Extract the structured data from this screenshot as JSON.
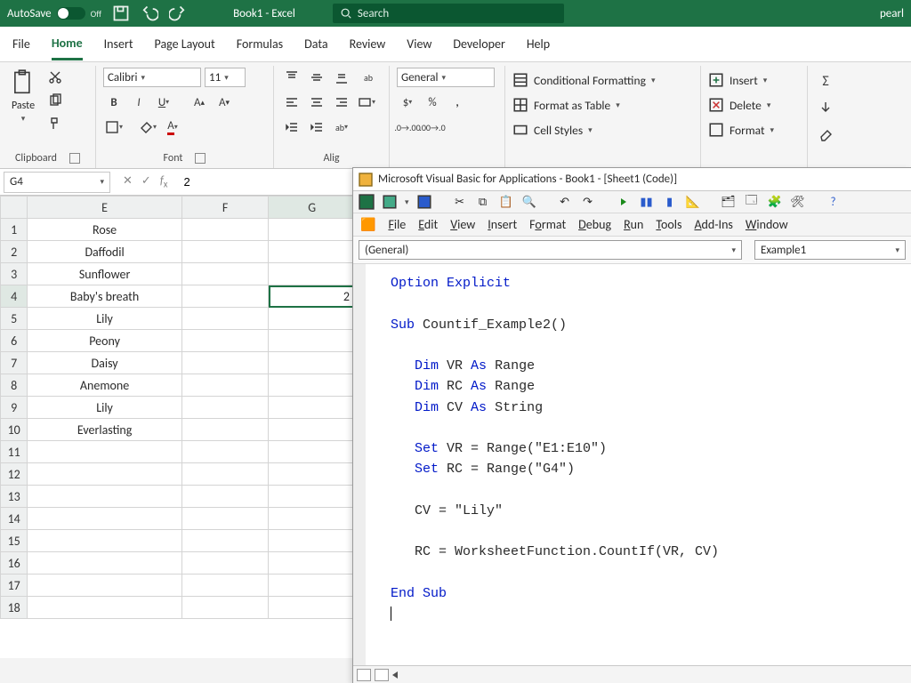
{
  "titlebar": {
    "autosave": "AutoSave",
    "autosave_state": "Off",
    "booktitle": "Book1 - Excel",
    "search_placeholder": "Search",
    "user": "pearl"
  },
  "tabs": {
    "file": "File",
    "home": "Home",
    "insert": "Insert",
    "page_layout": "Page Layout",
    "formulas": "Formulas",
    "data": "Data",
    "review": "Review",
    "view": "View",
    "developer": "Developer",
    "help": "Help"
  },
  "ribbon": {
    "clipboard": {
      "label": "Clipboard",
      "paste": "Paste"
    },
    "font": {
      "label": "Font",
      "name": "Calibri",
      "size": "11"
    },
    "alignment": {
      "label": "Alig"
    },
    "number": {
      "format": "General"
    },
    "styles": {
      "cond_fmt": "Conditional Formatting",
      "fmt_table": "Format as Table",
      "cell_styles": "Cell Styles"
    },
    "cells": {
      "insert": "Insert",
      "delete": "Delete",
      "format": "Format"
    }
  },
  "fxbar": {
    "namebox": "G4",
    "value": "2"
  },
  "grid": {
    "col_e": "E",
    "col_f": "F",
    "col_g": "G",
    "rows": [
      "Rose",
      "Daffodil",
      "Sunflower",
      "Baby's breath",
      "Lily",
      "Peony",
      "Daisy",
      "Anemone",
      "Lily",
      "Everlasting",
      "",
      "",
      "",
      "",
      "",
      "",
      "",
      ""
    ],
    "g4": "2"
  },
  "vba": {
    "title": "Microsoft Visual Basic for Applications - Book1 - [Sheet1 (Code)]",
    "menu": {
      "file": "File",
      "edit": "Edit",
      "view": "View",
      "insert": "Insert",
      "format": "Format",
      "debug": "Debug",
      "run": "Run",
      "tools": "Tools",
      "addins": "Add-Ins",
      "window": "Window"
    },
    "combo_left": "(General)",
    "combo_right": "Example1",
    "code": {
      "opt": "Option Explicit",
      "sub": "Sub",
      "subname": " Countif_Example2()",
      "dim": "Dim",
      "as": "As",
      "set": "Set",
      "l1v": " VR ",
      "l1t": " Range",
      "l2v": " RC ",
      "l2t": " Range",
      "l3v": " CV ",
      "l3t": " String",
      "s1": " VR = Range(\"E1:E10\")",
      "s2": " RC = Range(\"G4\")",
      "cv": "   CV = \"Lily\"",
      "rc": "   RC = WorksheetFunction.CountIf(VR, CV)",
      "end": "End Sub"
    }
  }
}
